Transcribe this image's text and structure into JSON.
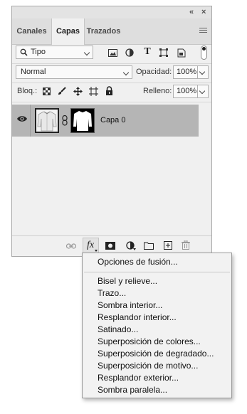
{
  "panel": {
    "collapse_glyph": "«",
    "close_glyph": "×",
    "tabs": [
      {
        "label": "Canales"
      },
      {
        "label": "Capas"
      },
      {
        "label": "Trazados"
      }
    ],
    "active_tab": "Capas",
    "filter": {
      "value": "Tipo",
      "icon": "search-icon"
    },
    "filter_icons": [
      "image-filter-icon",
      "adjustment-filter-icon",
      "type-filter-icon",
      "shape-filter-icon",
      "smart-object-filter-icon",
      "filter-toggle-icon"
    ],
    "blend_mode": "Normal",
    "opacity": {
      "label": "Opacidad:",
      "value": "100%"
    },
    "lock": {
      "label": "Bloq.:",
      "icons": [
        "lock-transparent-icon",
        "lock-paint-icon",
        "lock-move-icon",
        "lock-artboard-icon",
        "lock-all-icon"
      ]
    },
    "fill": {
      "label": "Relleno:",
      "value": "100%"
    },
    "layers": [
      {
        "name": "Capa 0",
        "visible": true,
        "selected": true
      }
    ],
    "bottom_icons": [
      "link-layers-icon",
      "fx-icon",
      "mask-icon",
      "adjustment-layer-icon",
      "group-folder-icon",
      "new-layer-icon",
      "trash-icon"
    ],
    "fx_label": "fx"
  },
  "menu": {
    "first_item": "Opciones de fusión...",
    "items": [
      "Bisel y relieve...",
      "Trazo...",
      "Sombra interior...",
      "Resplandor interior...",
      "Satinado...",
      "Superposición de colores...",
      "Superposición de degradado...",
      "Superposición de motivo...",
      "Resplandor exterior...",
      "Sombra paralela..."
    ]
  },
  "colors": {
    "panel_bg": "#f0f0f0",
    "selected_layer": "#b5b5b5",
    "menu_bg": "#f2f2f2"
  }
}
